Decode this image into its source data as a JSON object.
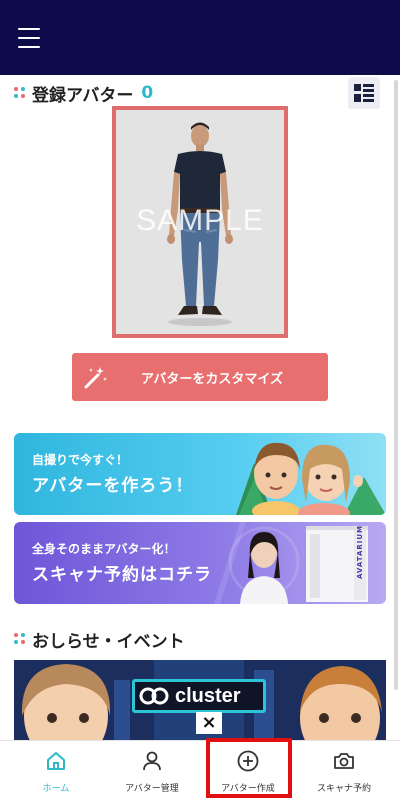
{
  "header": {
    "menu_icon": "hamburger-menu-icon"
  },
  "registered": {
    "title": "登録アバター",
    "count": "0",
    "view_toggle_icon": "list-view-icon",
    "sample_text": "SAMPLE"
  },
  "customize_button": {
    "label": "アバターをカスタマイズ",
    "icon": "magic-wand-icon"
  },
  "banners": [
    {
      "sub": "自撮りで今すぐ！",
      "main": "アバターを作ろう！"
    },
    {
      "sub": "全身そのままアバター化！",
      "main": "スキャナ予約はコチラ",
      "booth_text": "AVATARIUM"
    }
  ],
  "news": {
    "title": "おしらせ・イベント",
    "banner_brand": "cluster",
    "banner_cross": "×"
  },
  "bottom_nav": [
    {
      "label": "ホーム",
      "icon": "home-icon",
      "active": true
    },
    {
      "label": "アバター管理",
      "icon": "person-icon",
      "active": false
    },
    {
      "label": "アバター作成",
      "icon": "plus-circle-icon",
      "active": false
    },
    {
      "label": "スキャナ予約",
      "icon": "camera-icon",
      "active": false
    }
  ],
  "colors": {
    "header_bg": "#0d0b4a",
    "accent_teal": "#2fb8c7",
    "accent_coral": "#e86f6f",
    "highlight_red": "#e01010"
  }
}
